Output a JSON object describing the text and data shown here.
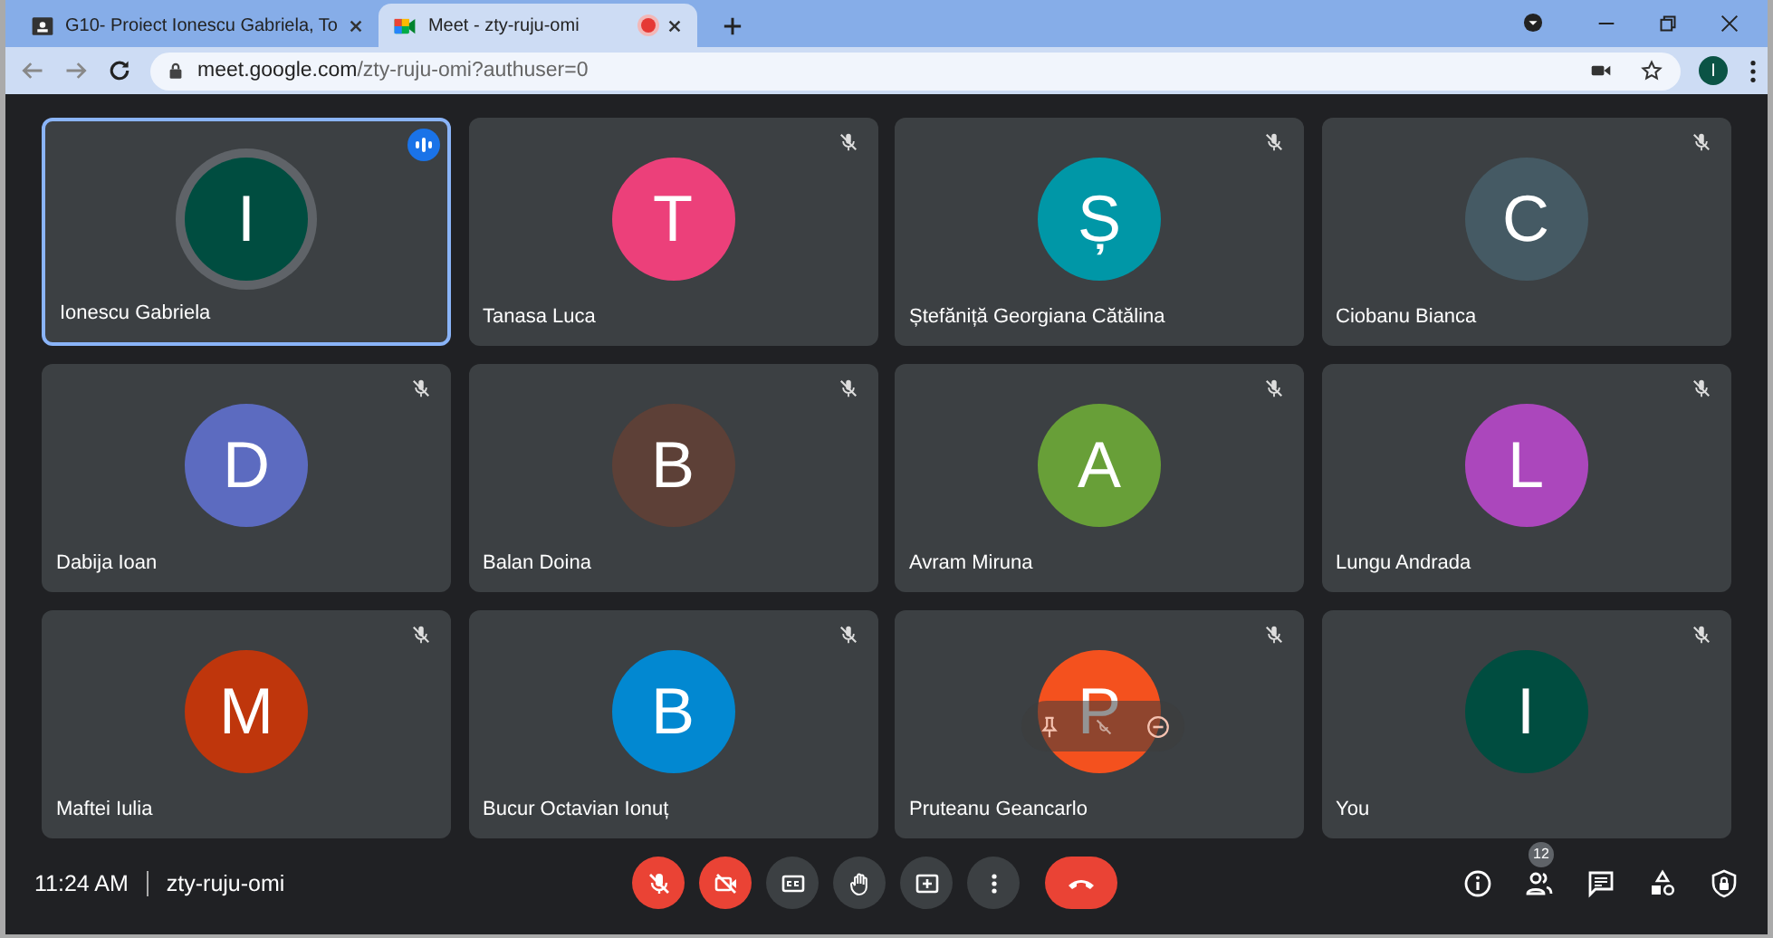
{
  "browser": {
    "tabs": [
      {
        "title": "G10- Proiect Ionescu Gabriela, To",
        "selected": false,
        "recording": false
      },
      {
        "title": "Meet - zty-ruju-omi",
        "selected": true,
        "recording": true
      }
    ],
    "address": {
      "domain": "meet.google.com",
      "path": "/zty-ruju-omi?authuser=0"
    },
    "profile_initial": "I"
  },
  "tiles": [
    {
      "name": "Ionescu Gabriela",
      "initial": "I",
      "color": "#004d40",
      "speaking": true,
      "muted": false,
      "hovered": false
    },
    {
      "name": "Tanasa Luca",
      "initial": "T",
      "color": "#ec407a",
      "speaking": false,
      "muted": true,
      "hovered": false
    },
    {
      "name": "Ștefăniță Georgiana Cătălina",
      "initial": "Ș",
      "color": "#0097a7",
      "speaking": false,
      "muted": true,
      "hovered": false
    },
    {
      "name": "Ciobanu Bianca",
      "initial": "C",
      "color": "#455a64",
      "speaking": false,
      "muted": true,
      "hovered": false
    },
    {
      "name": "Dabija Ioan",
      "initial": "D",
      "color": "#5c6bc0",
      "speaking": false,
      "muted": true,
      "hovered": false
    },
    {
      "name": "Balan Doina",
      "initial": "B",
      "color": "#5d4037",
      "speaking": false,
      "muted": true,
      "hovered": false
    },
    {
      "name": "Avram Miruna",
      "initial": "A",
      "color": "#689f38",
      "speaking": false,
      "muted": true,
      "hovered": false
    },
    {
      "name": "Lungu Andrada",
      "initial": "L",
      "color": "#ab47bc",
      "speaking": false,
      "muted": true,
      "hovered": false
    },
    {
      "name": "Maftei Iulia",
      "initial": "M",
      "color": "#bf360c",
      "speaking": false,
      "muted": true,
      "hovered": false
    },
    {
      "name": "Bucur Octavian Ionuț",
      "initial": "B",
      "color": "#0288d1",
      "speaking": false,
      "muted": true,
      "hovered": false
    },
    {
      "name": "Pruteanu Geancarlo",
      "initial": "P",
      "color": "#f4511e",
      "speaking": false,
      "muted": true,
      "hovered": true
    },
    {
      "name": "You",
      "initial": "I",
      "color": "#004d40",
      "speaking": false,
      "muted": true,
      "hovered": false
    }
  ],
  "bottom_bar": {
    "time": "11:24 AM",
    "meeting_code": "zty-ruju-omi",
    "controls": [
      {
        "kind": "mic",
        "on": false
      },
      {
        "kind": "camera",
        "on": false
      },
      {
        "kind": "captions"
      },
      {
        "kind": "hand"
      },
      {
        "kind": "present"
      },
      {
        "kind": "more"
      },
      {
        "kind": "hangup"
      }
    ],
    "people_count": "12"
  }
}
